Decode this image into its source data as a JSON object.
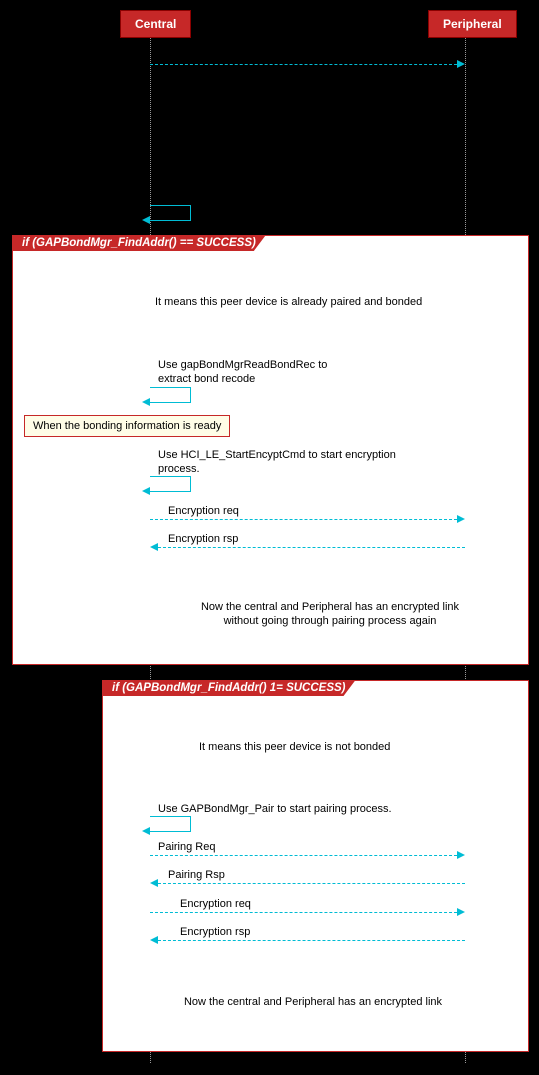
{
  "participants": {
    "central": "Central",
    "peripheral": "Peripheral"
  },
  "group1": {
    "title": "if (GAPBondMgr_FindAddr() == SUCCESS)",
    "note_paired": "It means this peer device is already paired and bonded",
    "step_read": "Use gapBondMgrReadBondRec to\nextract bond recode",
    "bonding_ready": "When the bonding information is ready",
    "step_encrypt": "Use HCI_LE_StartEncyptCmd to start encryption\nprocess.",
    "enc_req": "Encryption req",
    "enc_rsp": "Encryption rsp",
    "result": "Now the central and Peripheral has an encrypted link\nwithout going through pairing process again"
  },
  "group2": {
    "title": "if (GAPBondMgr_FindAddr() 1= SUCCESS)",
    "note_not_bonded": "It means this peer device is not bonded",
    "step_pair": "Use GAPBondMgr_Pair to start pairing process.",
    "pairing_req": "Pairing Req",
    "pairing_rsp": "Pairing Rsp",
    "enc_req": "Encryption req",
    "enc_rsp": "Encryption rsp",
    "result": "Now the central and Peripheral has an encrypted link"
  }
}
